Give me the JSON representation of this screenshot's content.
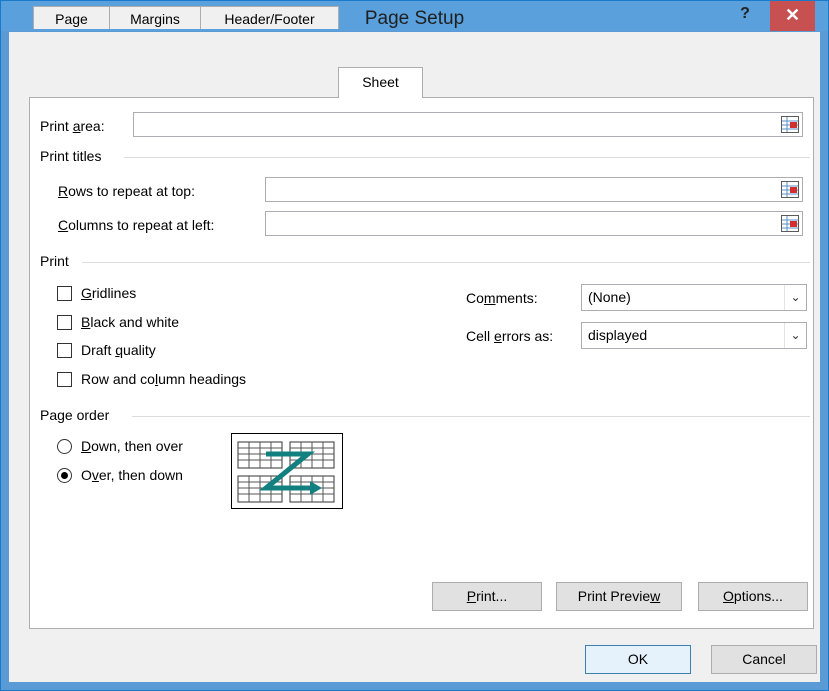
{
  "window": {
    "title": "Page Setup",
    "help": "?",
    "close": "✕"
  },
  "tabs": [
    {
      "label": "Page"
    },
    {
      "label": "Margins"
    },
    {
      "label": "Header/Footer"
    },
    {
      "label": "Sheet",
      "active": true
    }
  ],
  "print_area": {
    "pre": "Print ",
    "key": "a",
    "post": "rea:",
    "value": ""
  },
  "print_titles": {
    "heading": "Print titles",
    "rows": {
      "key": "R",
      "post": "ows to repeat at top:",
      "value": ""
    },
    "cols": {
      "key": "C",
      "post": "olumns to repeat at left:",
      "value": ""
    }
  },
  "print": {
    "heading": "Print",
    "gridlines": {
      "key": "G",
      "post": "ridlines",
      "checked": false
    },
    "bw": {
      "key": "B",
      "post": "lack and white",
      "checked": false
    },
    "draft": {
      "pre": "Draft ",
      "key": "q",
      "post": "uality",
      "checked": false
    },
    "headings": {
      "pre": "Row and co",
      "key": "l",
      "post": "umn headings",
      "checked": false
    },
    "comments": {
      "pre": "Co",
      "key": "m",
      "post": "ments:",
      "value": "(None)"
    },
    "errors": {
      "pre": "Cell ",
      "key": "e",
      "post": "rrors as:",
      "value": "displayed"
    }
  },
  "page_order": {
    "heading": "Page order",
    "down": {
      "key": "D",
      "post": "own, then over",
      "selected": false
    },
    "over": {
      "pre": "O",
      "key": "v",
      "post": "er, then down",
      "selected": true
    }
  },
  "buttons": {
    "print": {
      "key": "P",
      "post": "rint..."
    },
    "preview": {
      "pre": "Print Previe",
      "key": "w"
    },
    "options": {
      "key": "O",
      "post": "ptions..."
    },
    "ok": "OK",
    "cancel": "Cancel"
  },
  "colors": {
    "accent": "#59a0dc",
    "close": "#c75050",
    "arrow": "#138080"
  }
}
